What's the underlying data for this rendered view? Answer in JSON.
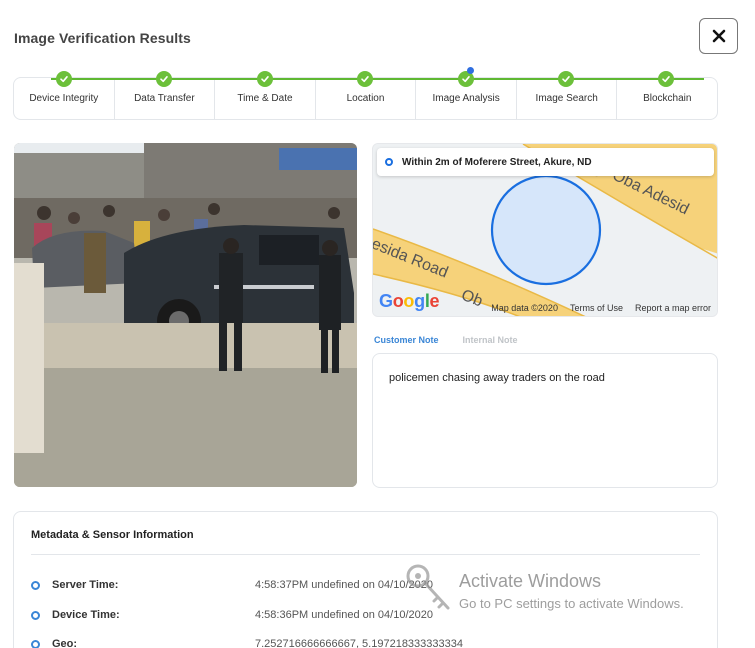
{
  "modal": {
    "title": "Image Verification Results",
    "close_icon": "close-icon"
  },
  "stepper": {
    "steps": [
      {
        "label": "Device Integrity",
        "status": "complete"
      },
      {
        "label": "Data Transfer",
        "status": "complete"
      },
      {
        "label": "Time & Date",
        "status": "complete"
      },
      {
        "label": "Location",
        "status": "complete"
      },
      {
        "label": "Image Analysis",
        "status": "complete",
        "active": true
      },
      {
        "label": "Image Search",
        "status": "complete"
      },
      {
        "label": "Blockchain",
        "status": "complete"
      }
    ],
    "complete_color": "#6cc03a",
    "active_indicator_color": "#2f6ee0"
  },
  "map": {
    "location_text": "Within 2m of Moferere Street, Akure, ND",
    "road_labels": [
      "Oba Adesid",
      "esida Road",
      "Ob"
    ],
    "provider_logo": "Google",
    "footer": {
      "map_data": "Map data ©2020",
      "terms": "Terms of Use",
      "report": "Report a map error"
    }
  },
  "notes": {
    "tabs": [
      {
        "label": "Customer Note",
        "active": true
      },
      {
        "label": "Internal Note",
        "active": false
      }
    ],
    "customer_note": "policemen chasing away traders on the road"
  },
  "metadata": {
    "title": "Metadata & Sensor Information",
    "rows": [
      {
        "key": "Server Time:",
        "value": "4:58:37PM undefined on 04/10/2020"
      },
      {
        "key": "Device Time:",
        "value": "4:58:36PM undefined on 04/10/2020"
      },
      {
        "key": "Geo:",
        "value": "7.252716666666667, 5.197218333333334"
      }
    ],
    "accent_color": "#3a86d6"
  },
  "watermark": {
    "title": "Activate Windows",
    "subtitle": "Go to PC settings to activate Windows."
  }
}
